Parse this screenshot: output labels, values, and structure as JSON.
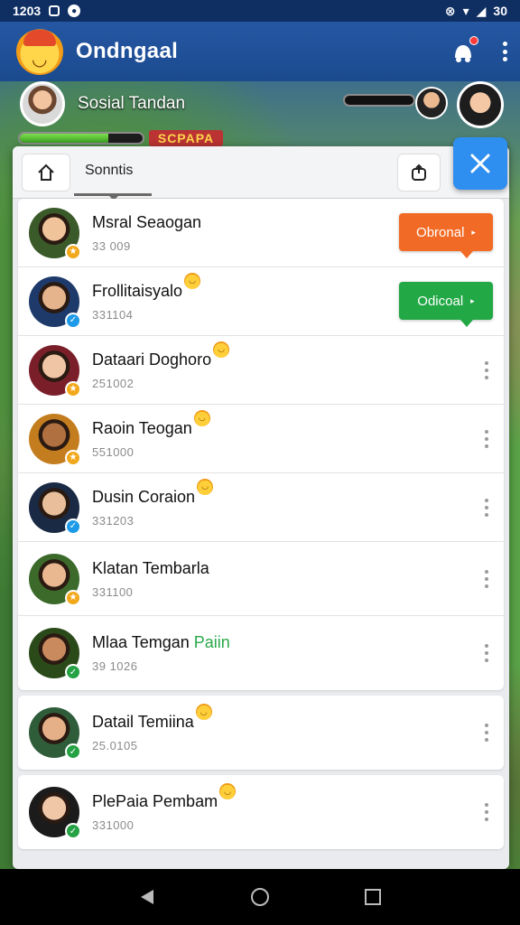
{
  "status_bar": {
    "time": "1203",
    "right_text": "30"
  },
  "app_bar": {
    "title": "Ondngaal"
  },
  "game_hud": {
    "player_name": "Sosial Tandan",
    "banner_text": "SCPAPA",
    "player_health_pct": 72
  },
  "tabs": {
    "search_label": "Sonntis"
  },
  "friends": [
    {
      "name": "Msral Seaogan",
      "sub": "33 009",
      "badge": "gold",
      "action": {
        "label": "Obronal",
        "color": "#f26b26"
      },
      "emoji": false
    },
    {
      "name": "Frollitaisyalo",
      "sub": "331104",
      "badge": "blue",
      "action": {
        "label": "Odicoal",
        "color": "#23a846"
      },
      "emoji": true
    },
    {
      "name": "Dataari Doghoro",
      "sub": "251002",
      "badge": "gold",
      "emoji": true
    },
    {
      "name": "Raoin Teogan",
      "sub": "551000",
      "badge": "gold",
      "emoji": true
    },
    {
      "name": "Dusin Coraion",
      "sub": "331203",
      "badge": "blue",
      "emoji": true
    },
    {
      "name": "Klatan Tembarla",
      "sub": "331100",
      "badge": "gold",
      "emoji": false
    },
    {
      "name": "Mlaa Temgan",
      "name_accent": "Paiin",
      "sub": "39 1026",
      "badge": "green",
      "emoji": false
    },
    {
      "name": "Datail Temiina",
      "sub": "25.0105",
      "badge": "green",
      "emoji": true
    },
    {
      "name": "PlePaia Pembam",
      "sub": "331000",
      "badge": "green",
      "emoji": true
    }
  ],
  "colors": {
    "app_bar": "#2557a3",
    "close_button": "#2f8ff0",
    "badge_gold": "#f2a81b",
    "badge_blue": "#1e9be8",
    "badge_green": "#25a244"
  },
  "icons": [
    "home-icon",
    "share-icon",
    "close-icon",
    "notification-icon",
    "more-vert-icon",
    "back-icon",
    "home-nav-icon",
    "recents-icon"
  ]
}
